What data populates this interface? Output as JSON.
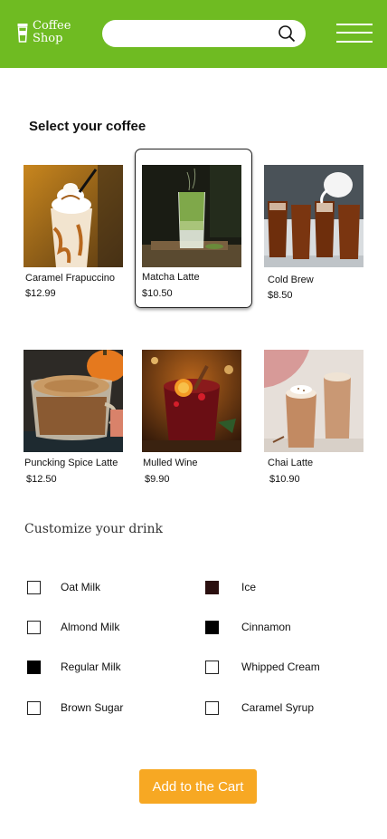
{
  "header": {
    "brand_line1": "Coffee",
    "brand_line2": "Shop",
    "search_value": "",
    "search_placeholder": "",
    "bg_color": "#6fbb22"
  },
  "menu": {
    "title": "Select your coffee",
    "items": [
      {
        "name": "Caramel Frapuccino",
        "price": "$12.99",
        "selected": false
      },
      {
        "name": "Matcha Latte",
        "price": "$10.50",
        "selected": true
      },
      {
        "name": "Cold Brew",
        "price": "$8.50",
        "selected": false
      },
      {
        "name": "Puncking Spice Latte",
        "price": "$12.50",
        "selected": false
      },
      {
        "name": "Mulled Wine",
        "price": "$9.90",
        "selected": false
      },
      {
        "name": "Chai Latte",
        "price": "$10.90",
        "selected": false
      }
    ]
  },
  "customize": {
    "title": "Customize your drink",
    "options": [
      {
        "label": "Oat Milk",
        "checked": false
      },
      {
        "label": "Ice",
        "checked": true
      },
      {
        "label": "Almond Milk",
        "checked": false
      },
      {
        "label": "Cinnamon",
        "checked": true
      },
      {
        "label": "Regular Milk",
        "checked": true
      },
      {
        "label": "Whipped Cream",
        "checked": false
      },
      {
        "label": "Brown Sugar",
        "checked": false
      },
      {
        "label": "Caramel Syrup",
        "checked": false
      }
    ]
  },
  "cart": {
    "label": "Add to the Cart",
    "color": "#f7a823"
  }
}
